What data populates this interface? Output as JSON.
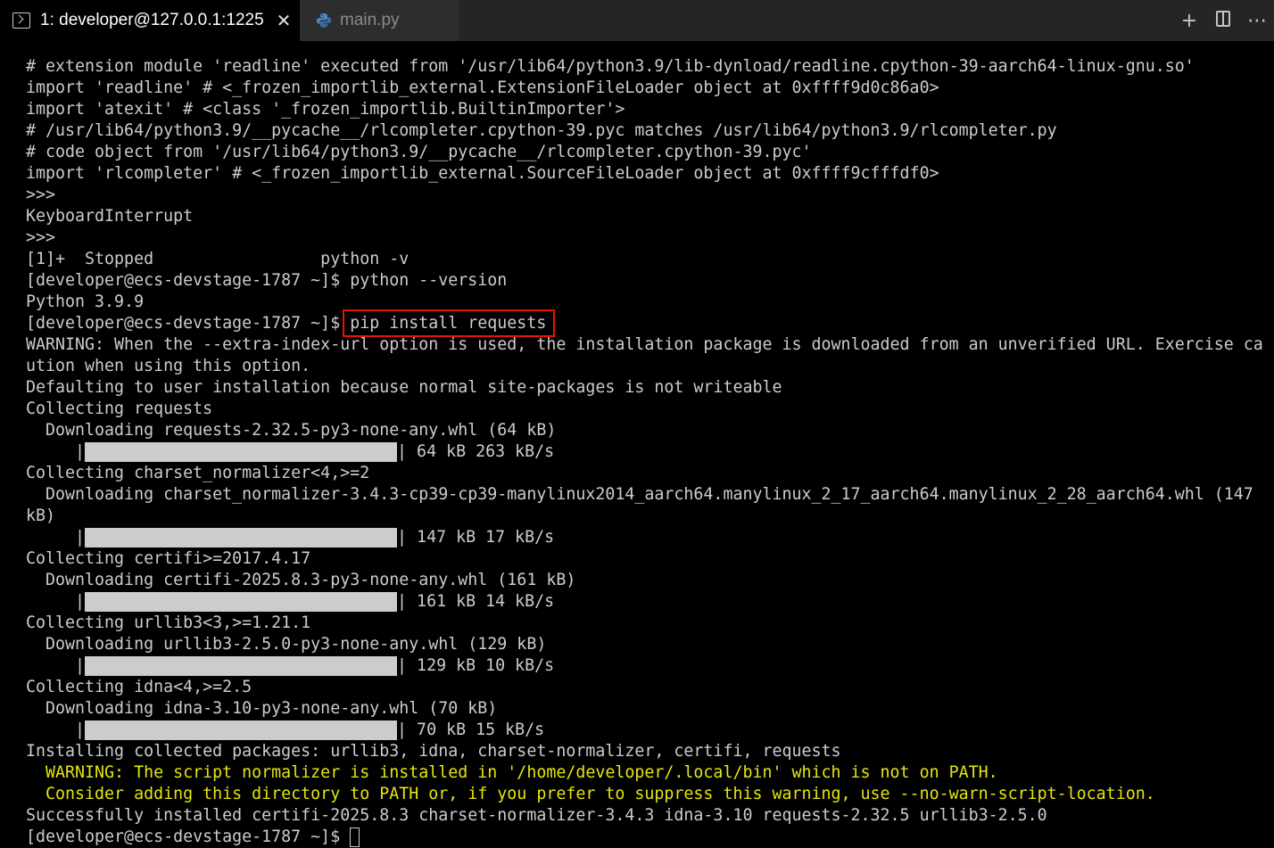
{
  "tabs": [
    {
      "label": "1: developer@127.0.0.1:1225",
      "icon": "terminal-icon",
      "active": true
    },
    {
      "label": "main.py",
      "icon": "python-icon",
      "active": false
    }
  ],
  "actions": [
    {
      "icon": "plus-icon",
      "glyph": "+"
    },
    {
      "icon": "split-editor-icon",
      "glyph": ""
    },
    {
      "icon": "more-icon",
      "glyph": "⋯"
    }
  ],
  "colors": {
    "background": "#000000",
    "text": "#cccccc",
    "warning": "#e5e510",
    "highlight_box": "#e51400",
    "progress_fill": "#cccccc"
  },
  "terminal": {
    "lines": [
      "# extension module 'readline' executed from '/usr/lib64/python3.9/lib-dynload/readline.cpython-39-aarch64-linux-gnu.so'",
      "import 'readline' # <_frozen_importlib_external.ExtensionFileLoader object at 0xffff9d0c86a0>",
      "import 'atexit' # <class '_frozen_importlib.BuiltinImporter'>",
      "# /usr/lib64/python3.9/__pycache__/rlcompleter.cpython-39.pyc matches /usr/lib64/python3.9/rlcompleter.py",
      "# code object from '/usr/lib64/python3.9/__pycache__/rlcompleter.cpython-39.pyc'",
      "import 'rlcompleter' # <_frozen_importlib_external.SourceFileLoader object at 0xffff9cfffdf0>",
      ">>>",
      "KeyboardInterrupt",
      ">>>",
      "[1]+  Stopped                 python -v",
      "[developer@ecs-devstage-1787 ~]$ python --version",
      "Python 3.9.9",
      "[developer@ecs-devstage-1787 ~]$ pip install requests",
      "WARNING: When the --extra-index-url option is used, the installation package is downloaded from an unverified URL. Exercise ca",
      "ution when using this option.",
      "Defaulting to user installation because normal site-packages is not writeable",
      "Collecting requests",
      "  Downloading requests-2.32.5-py3-none-any.whl (64 kB)",
      "     |",
      "Collecting charset_normalizer<4,>=2",
      "  Downloading charset_normalizer-3.4.3-cp39-cp39-manylinux2014_aarch64.manylinux_2_17_aarch64.manylinux_2_28_aarch64.whl (147",
      "kB)",
      "     |",
      "Collecting certifi>=2017.4.17",
      "  Downloading certifi-2025.8.3-py3-none-any.whl (161 kB)",
      "     |",
      "Collecting urllib3<3,>=1.21.1",
      "  Downloading urllib3-2.5.0-py3-none-any.whl (129 kB)",
      "     |",
      "Collecting idna<4,>=2.5",
      "  Downloading idna-3.10-py3-none-any.whl (70 kB)",
      "     |",
      "Installing collected packages: urllib3, idna, charset-normalizer, certifi, requests",
      "  WARNING: The script normalizer is installed in '/home/developer/.local/bin' which is not on PATH.",
      "  Consider adding this directory to PATH or, if you prefer to suppress this warning, use --no-warn-script-location.",
      "Successfully installed certifi-2025.8.3 charset-normalizer-3.4.3 idna-3.10 requests-2.32.5 urllib3-2.5.0",
      "[developer@ecs-devstage-1787 ~]$ "
    ],
    "progress": {
      "18": {
        "after": "| 64 kB 263 kB/s",
        "fraction": 1.0
      },
      "22": {
        "after": "| 147 kB 17 kB/s",
        "fraction": 1.0
      },
      "25": {
        "after": "| 161 kB 14 kB/s",
        "fraction": 1.0
      },
      "28": {
        "after": "| 129 kB 10 kB/s",
        "fraction": 1.0
      },
      "31": {
        "after": "| 70 kB 15 kB/s",
        "fraction": 1.0
      }
    },
    "warning_lines": [
      33,
      34
    ],
    "highlighted_command": "pip install requests",
    "cursor_line": 36
  }
}
